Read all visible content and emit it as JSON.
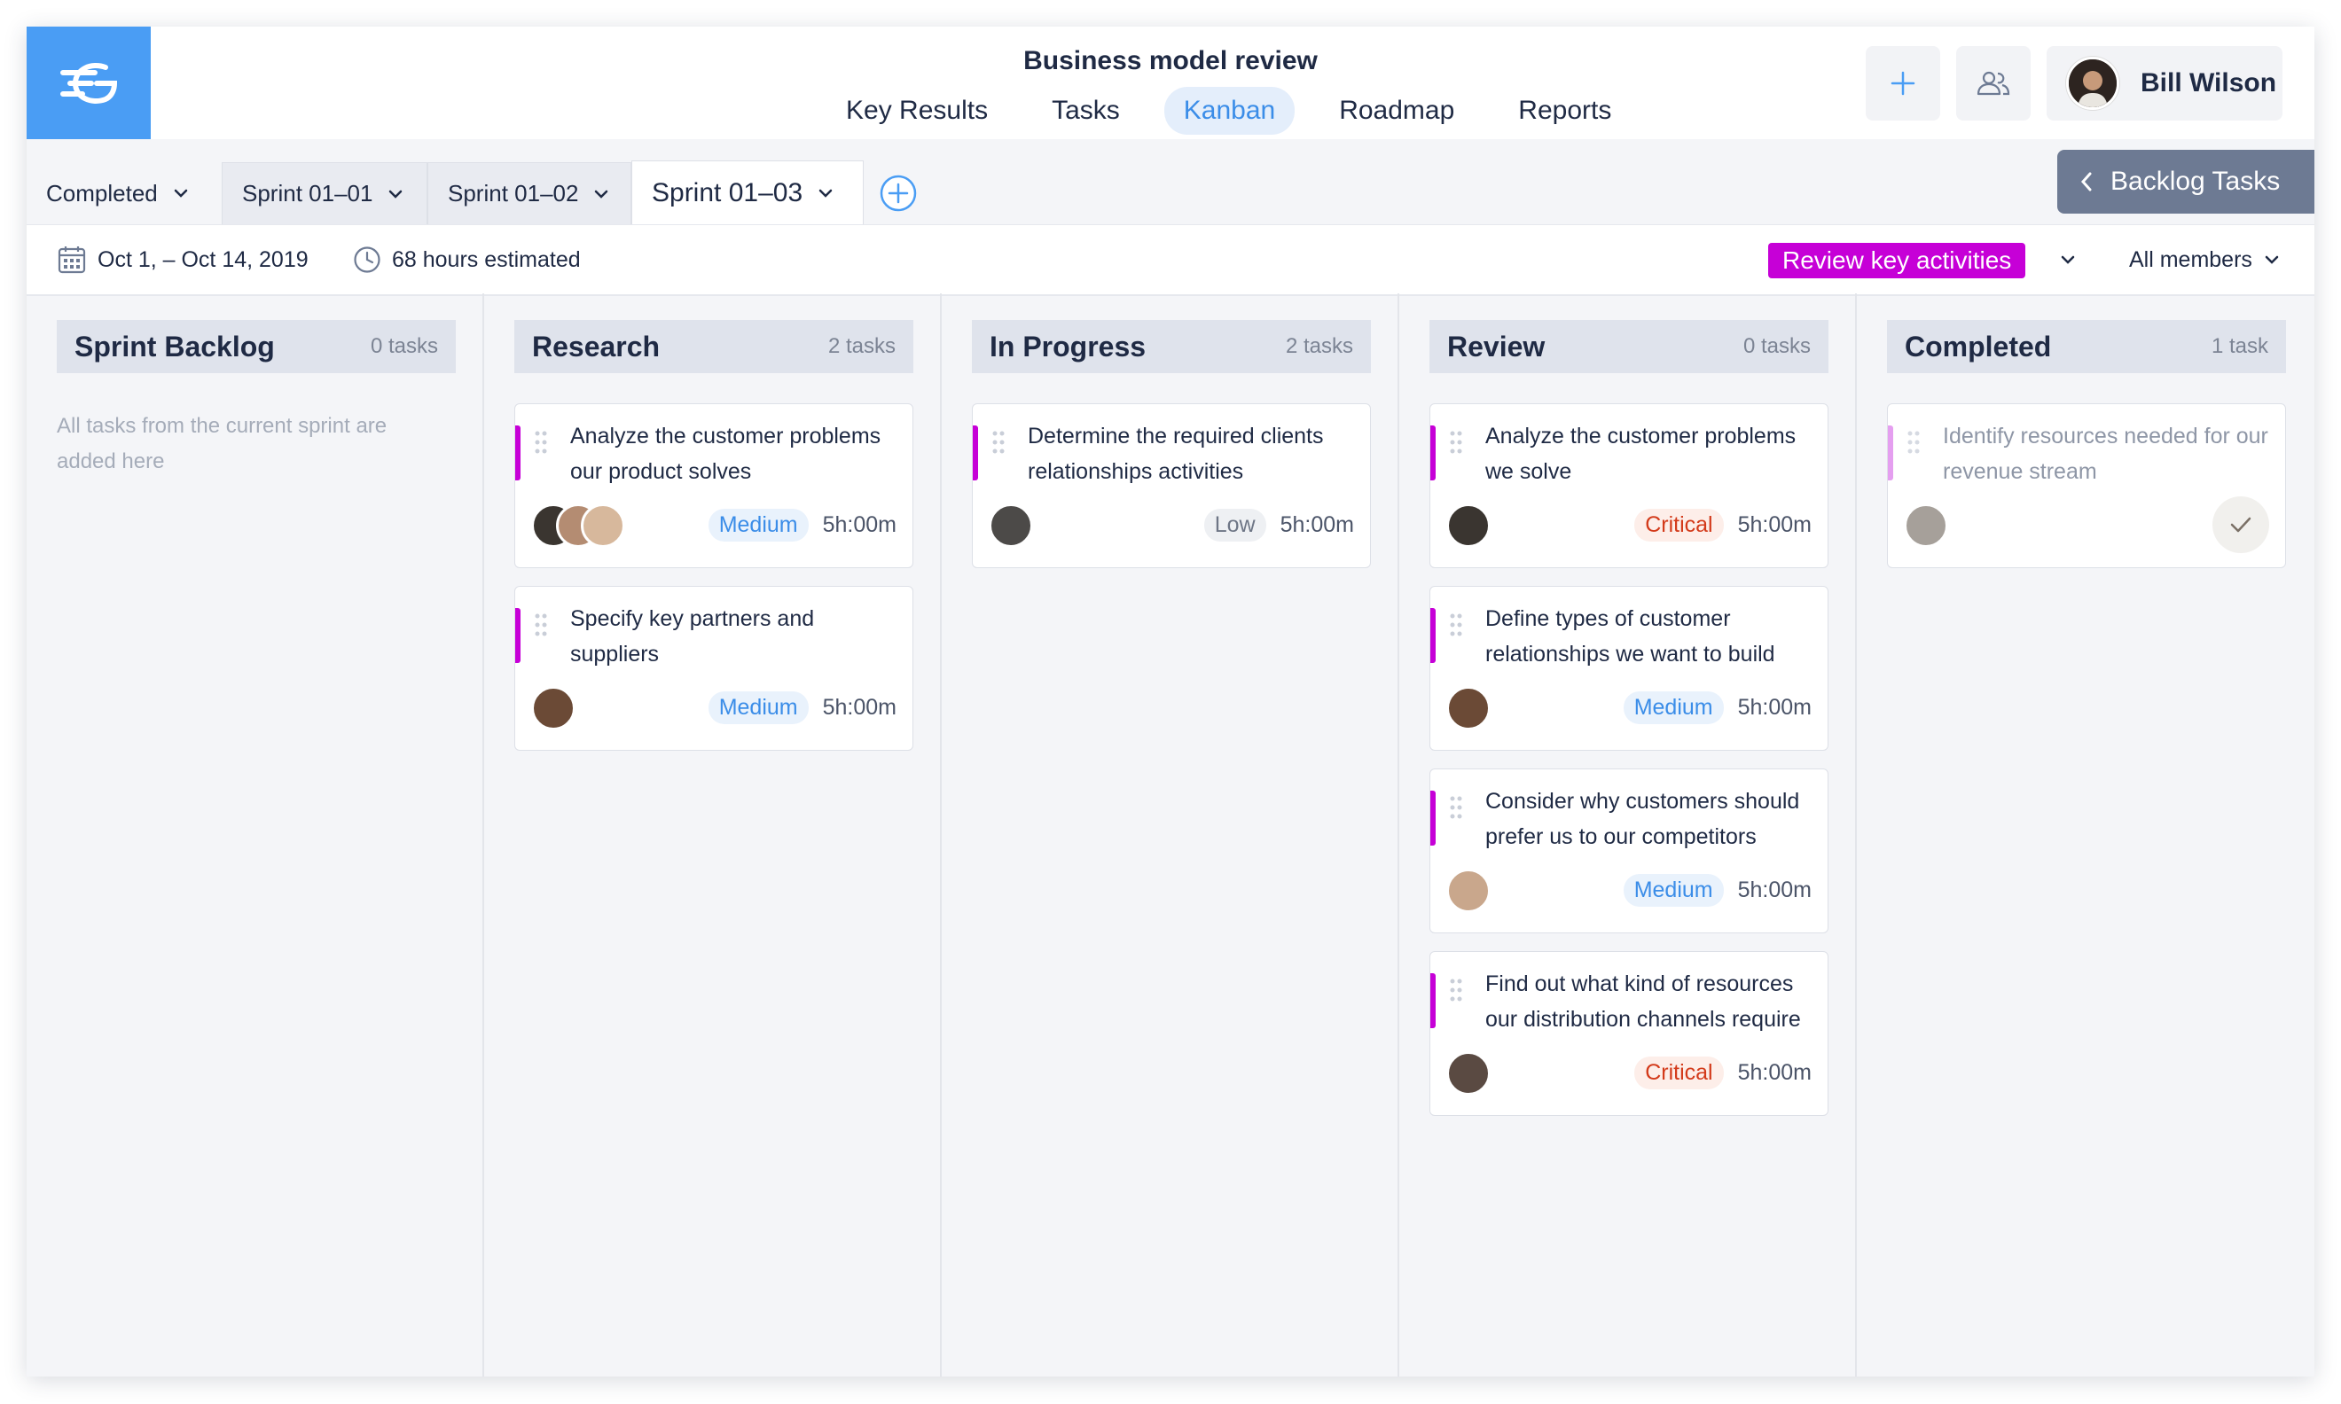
{
  "header": {
    "project_title": "Business model review",
    "nav": [
      "Key Results",
      "Tasks",
      "Kanban",
      "Roadmap",
      "Reports"
    ],
    "active_nav": "Kanban",
    "user": {
      "name": "Bill Wilson"
    }
  },
  "sprints": {
    "tabs": [
      {
        "label": "Completed"
      },
      {
        "label": "Sprint 01–01"
      },
      {
        "label": "Sprint 01–02"
      },
      {
        "label": "Sprint 01–03"
      }
    ],
    "active": "Sprint 01–03",
    "backlog_button": "Backlog Tasks"
  },
  "info": {
    "date_range": "Oct 1, – Oct 14, 2019",
    "hours": "68 hours estimated",
    "tag_filter": "Review key activities",
    "members_filter": "All members"
  },
  "columns": [
    {
      "title": "Sprint Backlog",
      "count": "0 tasks",
      "empty": "All tasks from the current sprint are added here",
      "cards": []
    },
    {
      "title": "Research",
      "count": "2 tasks",
      "cards": [
        {
          "title": "Analyze the customer problems our product solves",
          "priority": "Medium",
          "duration": "5h:00m"
        },
        {
          "title": "Specify key partners and suppliers",
          "priority": "Medium",
          "duration": "5h:00m"
        }
      ]
    },
    {
      "title": "In Progress",
      "count": "2 tasks",
      "cards": [
        {
          "title": "Determine the required clients relationships activities",
          "priority": "Low",
          "duration": "5h:00m"
        }
      ]
    },
    {
      "title": "Review",
      "count": "0 tasks",
      "cards": [
        {
          "title": "Analyze the customer problems we solve",
          "priority": "Critical",
          "duration": "5h:00m"
        },
        {
          "title": "Define types of customer relationships we want to build",
          "priority": "Medium",
          "duration": "5h:00m"
        },
        {
          "title": "Consider why customers should prefer us to our competitors",
          "priority": "Medium",
          "duration": "5h:00m"
        },
        {
          "title": "Find out what kind of resources our distribution channels require",
          "priority": "Critical",
          "duration": "5h:00m"
        }
      ]
    },
    {
      "title": "Completed",
      "count": "1 task",
      "cards": [
        {
          "title": "Identify resources needed for our revenue stream"
        }
      ]
    }
  ],
  "colors": {
    "accent": "#4a9df4",
    "tag": "#c600d7",
    "backlog_button": "#6d7a93"
  },
  "icons": {
    "logo": "logo-icon",
    "add": "plus-icon",
    "team": "people-icon",
    "calendar": "calendar-icon",
    "clock": "clock-icon",
    "drag": "grip-icon",
    "done": "check-icon"
  }
}
